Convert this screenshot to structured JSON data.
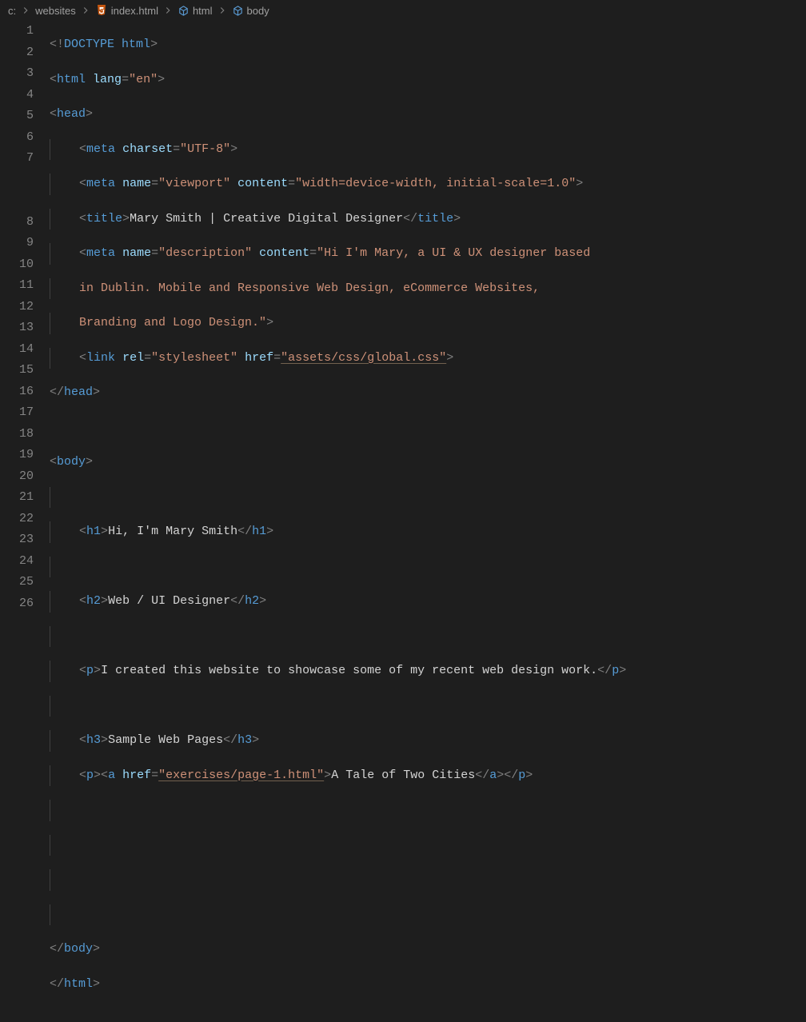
{
  "breadcrumb": {
    "items": [
      {
        "label": "c:",
        "icon": null
      },
      {
        "label": "websites",
        "icon": null
      },
      {
        "label": "index.html",
        "icon": "file-html"
      },
      {
        "label": "html",
        "icon": "symbol"
      },
      {
        "label": "body",
        "icon": "symbol"
      }
    ]
  },
  "lineNumbers": [
    "1",
    "2",
    "3",
    "4",
    "5",
    "6",
    "7",
    "",
    "",
    "8",
    "9",
    "10",
    "11",
    "12",
    "13",
    "14",
    "15",
    "16",
    "17",
    "18",
    "19",
    "20",
    "21",
    "22",
    "23",
    "24",
    "25",
    "26"
  ],
  "code": {
    "line1": {
      "doctype": "DOCTYPE",
      "root": "html"
    },
    "line2": {
      "tag": "html",
      "attr": "lang",
      "val": "\"en\""
    },
    "line3": {
      "tag": "head"
    },
    "line4": {
      "tag": "meta",
      "attr": "charset",
      "val": "\"UTF-8\""
    },
    "line5": {
      "tag": "meta",
      "attr1": "name",
      "val1": "\"viewport\"",
      "attr2": "content",
      "val2": "\"width=device-width, initial-scale=1.0\""
    },
    "line6": {
      "tag": "title",
      "text": "Mary Smith | Creative Digital Designer",
      "close": "title"
    },
    "line7": {
      "tag": "meta",
      "attr1": "name",
      "val1": "\"description\"",
      "attr2": "content",
      "val2a": "\"Hi I'm Mary, a UI & UX designer based ",
      "val2b": "in Dublin. Mobile and Responsive Web Design, eCommerce Websites, ",
      "val2c": "Branding and Logo Design.\""
    },
    "line8": {
      "tag": "link",
      "attr1": "rel",
      "val1": "\"stylesheet\"",
      "attr2": "href",
      "val2": "\"assets/css/global.css\""
    },
    "line9": {
      "close": "head"
    },
    "line11": {
      "tag": "body"
    },
    "line13": {
      "tag": "h1",
      "text": "Hi, I'm Mary Smith",
      "close": "h1"
    },
    "line15": {
      "tag": "h2",
      "text": "Web / UI Designer",
      "close": "h2"
    },
    "line17": {
      "tag": "p",
      "text": "I created this website to showcase some of my recent web design work.",
      "close": "p"
    },
    "line19": {
      "tag": "h3",
      "text": "Sample Web Pages",
      "close": "h3"
    },
    "line20": {
      "tag1": "p",
      "tag2": "a",
      "attr": "href",
      "val": "\"exercises/page-1.html\"",
      "text": "A Tale of Two Cities",
      "close2": "a",
      "close1": "p"
    },
    "line25": {
      "close": "body"
    },
    "line26": {
      "close": "html"
    }
  }
}
